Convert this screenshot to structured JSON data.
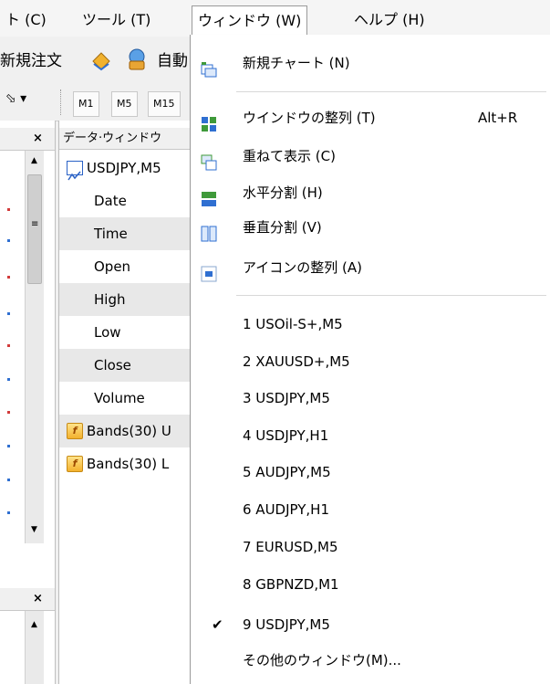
{
  "menubar": {
    "items": [
      {
        "label": "ト (C)"
      },
      {
        "label": "ツール (T)"
      },
      {
        "label": "ウィンドウ (W)"
      },
      {
        "label": "ヘルプ (H)"
      }
    ]
  },
  "toolbar": {
    "new_order_label": "新規注文",
    "auto_label": "自動",
    "timeframes": [
      "M1",
      "M5",
      "M15"
    ]
  },
  "data_window": {
    "title": "データ·ウィンドウ",
    "symbol": "USDJPY,M5",
    "fields": [
      "Date",
      "Time",
      "Open",
      "High",
      "Low",
      "Close",
      "Volume"
    ],
    "indicators": [
      "Bands(30) U",
      "Bands(30) L"
    ]
  },
  "window_menu": {
    "new_chart": "新規チャート (N)",
    "tile": "ウインドウの整列 (T)",
    "tile_shortcut": "Alt+R",
    "cascade": "重ねて表示 (C)",
    "tile_horizontal": "水平分割 (H)",
    "tile_vertical": "垂直分割 (V)",
    "arrange_icons": "アイコンの整列 (A)",
    "windows": [
      "1 USOil-S+,M5",
      "2 XAUUSD+,M5",
      "3 USDJPY,M5",
      "4 USDJPY,H1",
      "5 AUDJPY,M5",
      "6 AUDJPY,H1",
      "7 EURUSD,M5",
      "8 GBPNZD,M1",
      "9 USDJPY,M5"
    ],
    "checked_index": 8,
    "more_windows": "その他のウィンドウ(M)..."
  },
  "colors": {
    "menu_icon_blue": "#2f6fd1",
    "menu_icon_green": "#3f9a3a",
    "indicator_icon": "#f3b12d"
  }
}
